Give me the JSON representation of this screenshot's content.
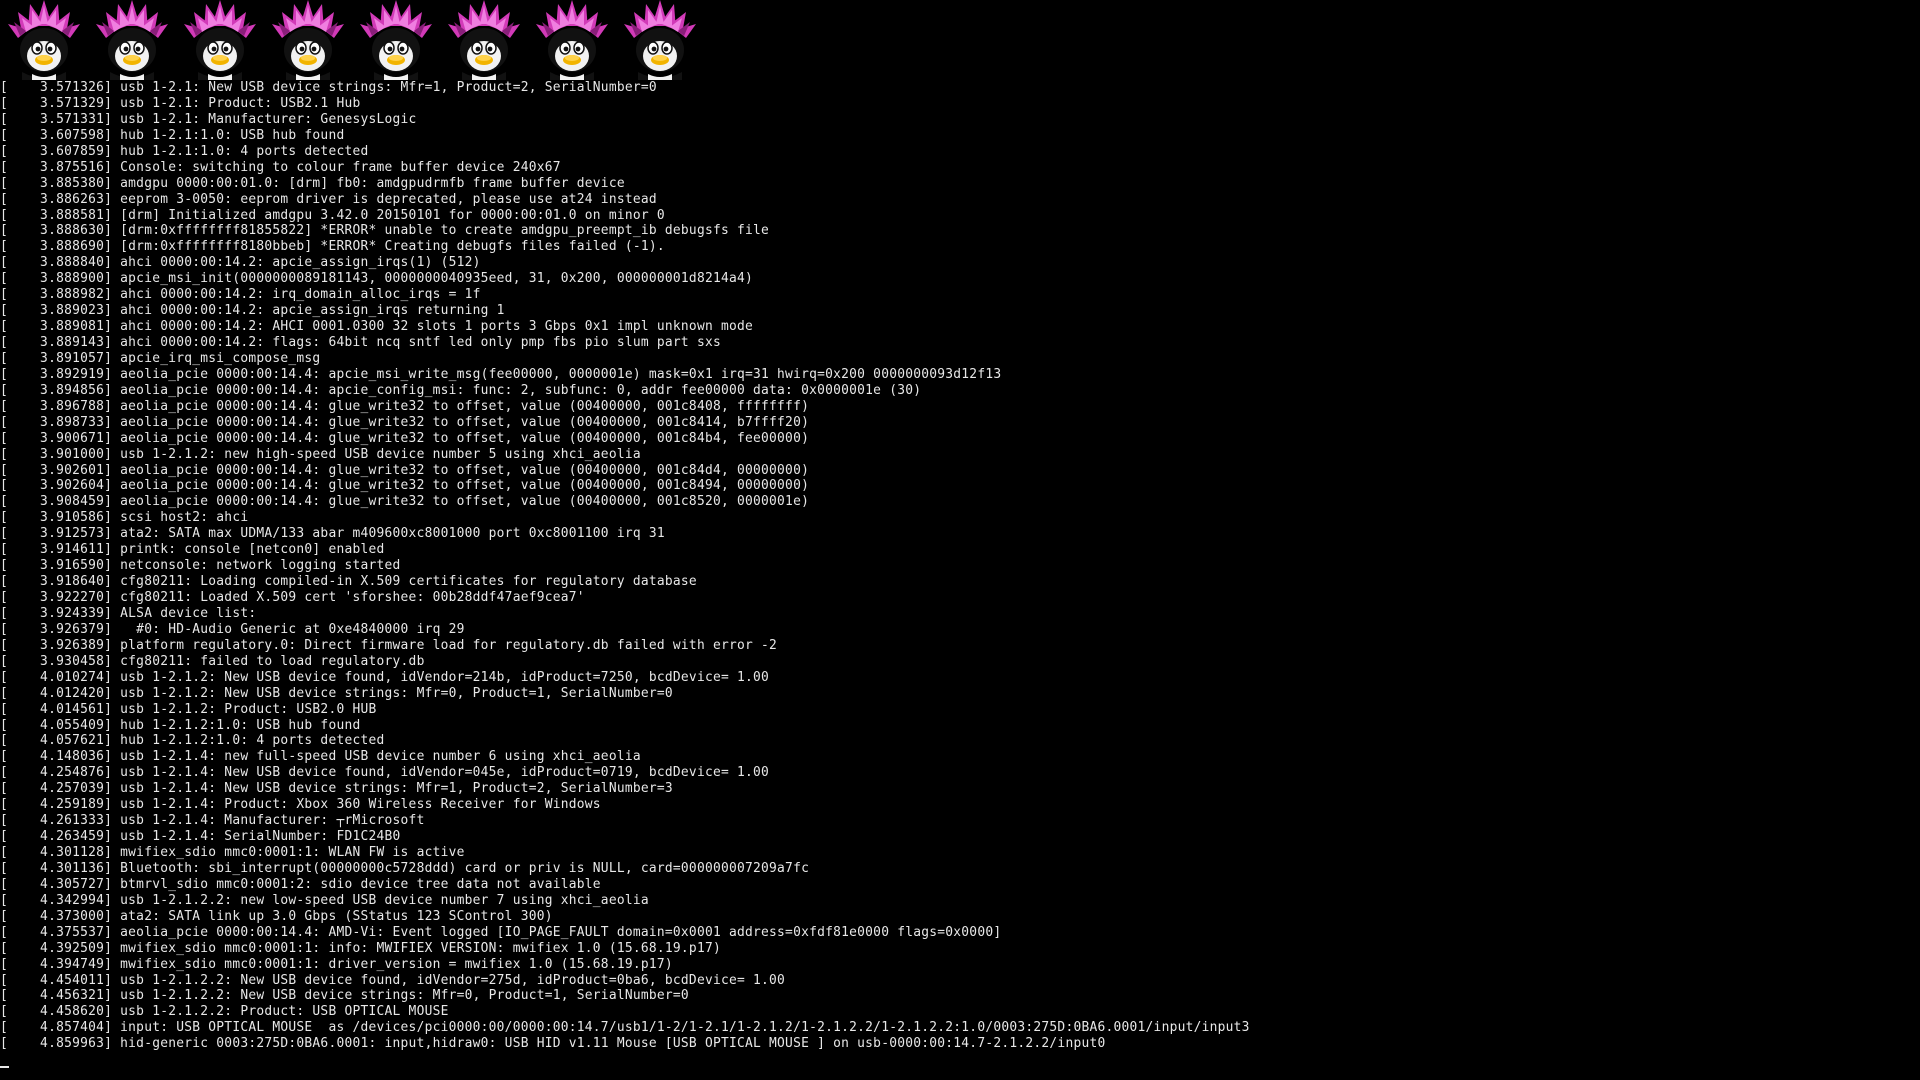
{
  "screen": {
    "background": "#000000",
    "foreground": "#e8e8e8",
    "logo": {
      "icon": "tux-penguin-icon",
      "count": 8,
      "hair_color": "#e040c8"
    },
    "cursor": "_"
  },
  "log_lines": [
    "[    3.571326] usb 1-2.1: New USB device strings: Mfr=1, Product=2, SerialNumber=0",
    "[    3.571329] usb 1-2.1: Product: USB2.1 Hub",
    "[    3.571331] usb 1-2.1: Manufacturer: GenesysLogic",
    "[    3.607598] hub 1-2.1:1.0: USB hub found",
    "[    3.607859] hub 1-2.1:1.0: 4 ports detected",
    "[    3.875516] Console: switching to colour frame buffer device 240x67",
    "[    3.885380] amdgpu 0000:00:01.0: [drm] fb0: amdgpudrmfb frame buffer device",
    "[    3.886263] eeprom 3-0050: eeprom driver is deprecated, please use at24 instead",
    "[    3.888581] [drm] Initialized amdgpu 3.42.0 20150101 for 0000:00:01.0 on minor 0",
    "[    3.888630] [drm:0xffffffff81855822] *ERROR* unable to create amdgpu_preempt_ib debugsfs file",
    "[    3.888690] [drm:0xffffffff8180bbeb] *ERROR* Creating debugfs files failed (-1).",
    "[    3.888840] ahci 0000:00:14.2: apcie_assign_irqs(1) (512)",
    "[    3.888900] apcie_msi_init(0000000089181143, 0000000040935eed, 31, 0x200, 000000001d8214a4)",
    "[    3.888982] ahci 0000:00:14.2: irq_domain_alloc_irqs = 1f",
    "[    3.889023] ahci 0000:00:14.2: apcie_assign_irqs returning 1",
    "[    3.889081] ahci 0000:00:14.2: AHCI 0001.0300 32 slots 1 ports 3 Gbps 0x1 impl unknown mode",
    "[    3.889143] ahci 0000:00:14.2: flags: 64bit ncq sntf led only pmp fbs pio slum part sxs",
    "[    3.891057] apcie_irq_msi_compose_msg",
    "[    3.892919] aeolia_pcie 0000:00:14.4: apcie_msi_write_msg(fee00000, 0000001e) mask=0x1 irq=31 hwirq=0x200 0000000093d12f13",
    "[    3.894856] aeolia_pcie 0000:00:14.4: apcie_config_msi: func: 2, subfunc: 0, addr fee00000 data: 0x0000001e (30)",
    "[    3.896788] aeolia_pcie 0000:00:14.4: glue_write32 to offset, value (00400000, 001c8408, ffffffff)",
    "[    3.898733] aeolia_pcie 0000:00:14.4: glue_write32 to offset, value (00400000, 001c8414, b7ffff20)",
    "[    3.900671] aeolia_pcie 0000:00:14.4: glue_write32 to offset, value (00400000, 001c84b4, fee00000)",
    "[    3.901000] usb 1-2.1.2: new high-speed USB device number 5 using xhci_aeolia",
    "[    3.902601] aeolia_pcie 0000:00:14.4: glue_write32 to offset, value (00400000, 001c84d4, 00000000)",
    "[    3.902604] aeolia_pcie 0000:00:14.4: glue_write32 to offset, value (00400000, 001c8494, 00000000)",
    "[    3.908459] aeolia_pcie 0000:00:14.4: glue_write32 to offset, value (00400000, 001c8520, 0000001e)",
    "[    3.910586] scsi host2: ahci",
    "[    3.912573] ata2: SATA max UDMA/133 abar m409600xc8001000 port 0xc8001100 irq 31",
    "[    3.914611] printk: console [netcon0] enabled",
    "[    3.916590] netconsole: network logging started",
    "[    3.918640] cfg80211: Loading compiled-in X.509 certificates for regulatory database",
    "[    3.922270] cfg80211: Loaded X.509 cert 'sforshee: 00b28ddf47aef9cea7'",
    "[    3.924339] ALSA device list:",
    "[    3.926379]   #0: HD-Audio Generic at 0xe4840000 irq 29",
    "[    3.926389] platform regulatory.0: Direct firmware load for regulatory.db failed with error -2",
    "[    3.930458] cfg80211: failed to load regulatory.db",
    "[    4.010274] usb 1-2.1.2: New USB device found, idVendor=214b, idProduct=7250, bcdDevice= 1.00",
    "[    4.012420] usb 1-2.1.2: New USB device strings: Mfr=0, Product=1, SerialNumber=0",
    "[    4.014561] usb 1-2.1.2: Product: USB2.0 HUB",
    "[    4.055409] hub 1-2.1.2:1.0: USB hub found",
    "[    4.057621] hub 1-2.1.2:1.0: 4 ports detected",
    "[    4.148036] usb 1-2.1.4: new full-speed USB device number 6 using xhci_aeolia",
    "[    4.254876] usb 1-2.1.4: New USB device found, idVendor=045e, idProduct=0719, bcdDevice= 1.00",
    "[    4.257039] usb 1-2.1.4: New USB device strings: Mfr=1, Product=2, SerialNumber=3",
    "[    4.259189] usb 1-2.1.4: Product: Xbox 360 Wireless Receiver for Windows",
    "[    4.261333] usb 1-2.1.4: Manufacturer: ┬rMicrosoft",
    "[    4.263459] usb 1-2.1.4: SerialNumber: FD1C24B0",
    "[    4.301128] mwifiex_sdio mmc0:0001:1: WLAN FW is active",
    "[    4.301136] Bluetooth: sbi_interrupt(00000000c5728ddd) card or priv is NULL, card=000000007209a7fc",
    "[    4.305727] btmrvl_sdio mmc0:0001:2: sdio device tree data not available",
    "[    4.342994] usb 1-2.1.2.2: new low-speed USB device number 7 using xhci_aeolia",
    "[    4.373000] ata2: SATA link up 3.0 Gbps (SStatus 123 SControl 300)",
    "[    4.375537] aeolia_pcie 0000:00:14.4: AMD-Vi: Event logged [IO_PAGE_FAULT domain=0x0001 address=0xfdf81e0000 flags=0x0000]",
    "[    4.392509] mwifiex_sdio mmc0:0001:1: info: MWIFIEX VERSION: mwifiex 1.0 (15.68.19.p17)",
    "[    4.394749] mwifiex_sdio mmc0:0001:1: driver_version = mwifiex 1.0 (15.68.19.p17)",
    "[    4.454011] usb 1-2.1.2.2: New USB device found, idVendor=275d, idProduct=0ba6, bcdDevice= 1.00",
    "[    4.456321] usb 1-2.1.2.2: New USB device strings: Mfr=0, Product=1, SerialNumber=0",
    "[    4.458620] usb 1-2.1.2.2: Product: USB OPTICAL MOUSE",
    "[    4.857404] input: USB OPTICAL MOUSE  as /devices/pci0000:00/0000:00:14.7/usb1/1-2/1-2.1/1-2.1.2/1-2.1.2.2/1-2.1.2.2:1.0/0003:275D:0BA6.0001/input/input3",
    "[    4.859963] hid-generic 0003:275D:0BA6.0001: input,hidraw0: USB HID v1.11 Mouse [USB OPTICAL MOUSE ] on usb-0000:00:14.7-2.1.2.2/input0"
  ]
}
